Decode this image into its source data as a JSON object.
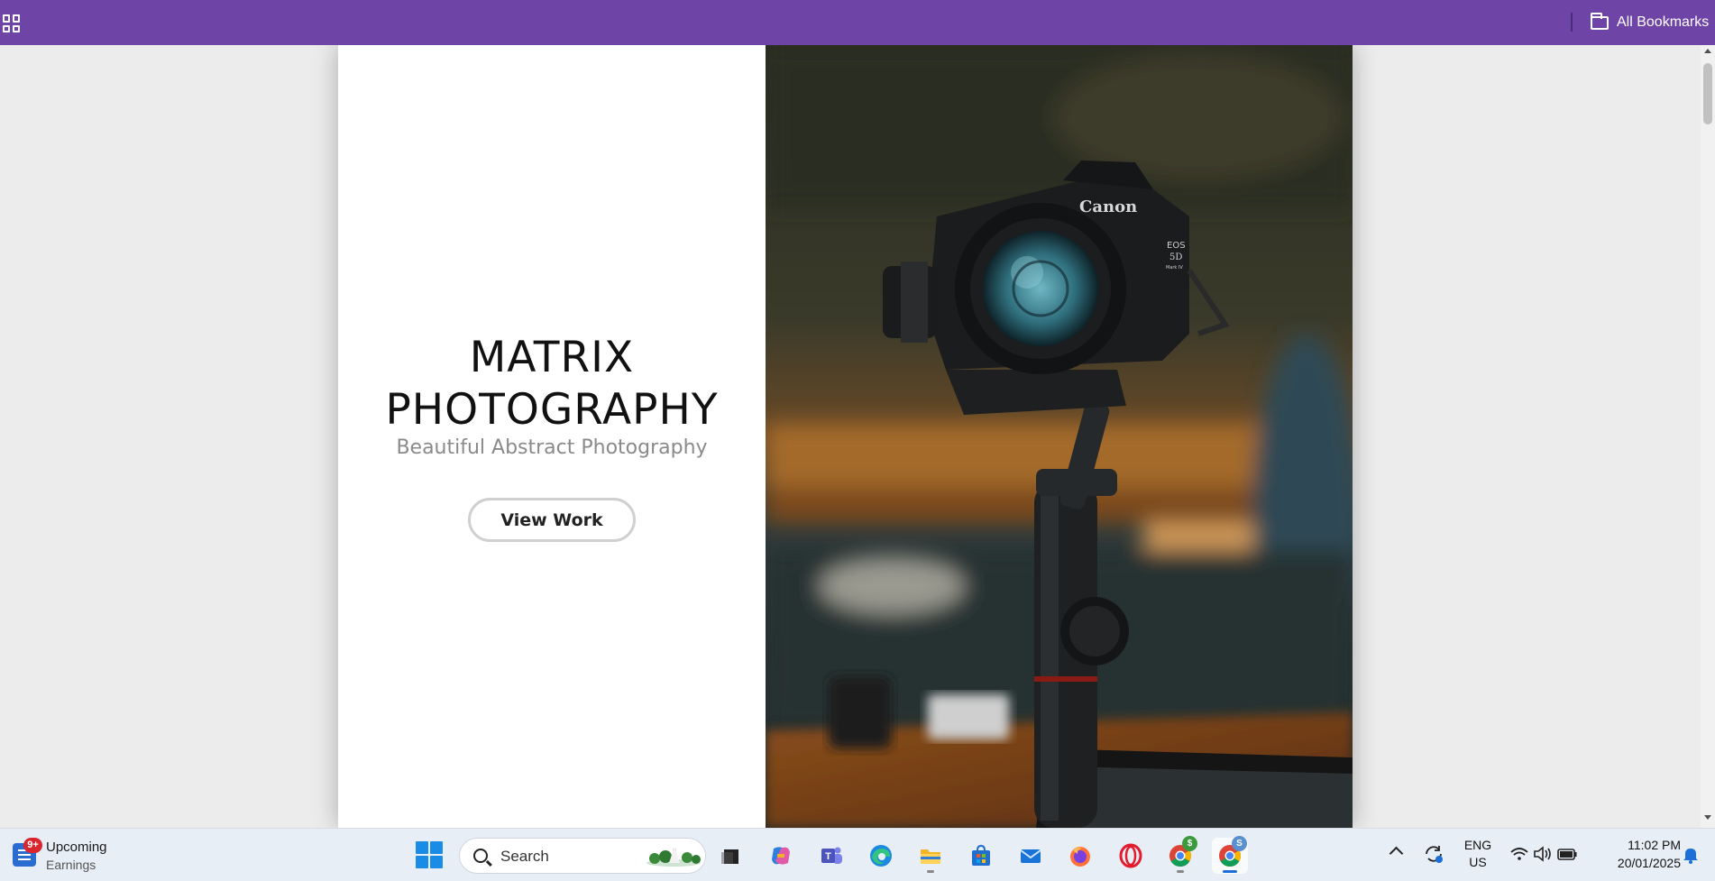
{
  "browser": {
    "bookmarks_bar": {
      "apps_icon": "apps-grid-icon",
      "all_bookmarks_label": "All Bookmarks",
      "folder_icon": "folder-icon",
      "background": "#6e44a6"
    }
  },
  "page": {
    "hero": {
      "title_line1": "MATRIX",
      "title_line2": "PHOTOGRAPHY",
      "subtitle": "Beautiful Abstract Photography",
      "cta_label": "View Work"
    },
    "photo": {
      "brand_text": "Canon",
      "model_line1": "EOS",
      "model_line2": "5D",
      "model_line3": "Mark IV"
    }
  },
  "taskbar": {
    "widget": {
      "badge": "9+",
      "line1": "Upcoming",
      "line2": "Earnings"
    },
    "search_placeholder": "Search",
    "apps": [
      {
        "name": "task-view"
      },
      {
        "name": "copilot"
      },
      {
        "name": "teams"
      },
      {
        "name": "edge"
      },
      {
        "name": "file-explorer"
      },
      {
        "name": "microsoft-store"
      },
      {
        "name": "mail"
      },
      {
        "name": "firefox"
      },
      {
        "name": "opera"
      },
      {
        "name": "chrome-profile-1",
        "badge": "$"
      },
      {
        "name": "chrome-profile-2",
        "badge": "S"
      }
    ],
    "tray": {
      "lang_line1": "ENG",
      "lang_line2": "US",
      "time": "11:02 PM",
      "date": "20/01/2025"
    }
  }
}
